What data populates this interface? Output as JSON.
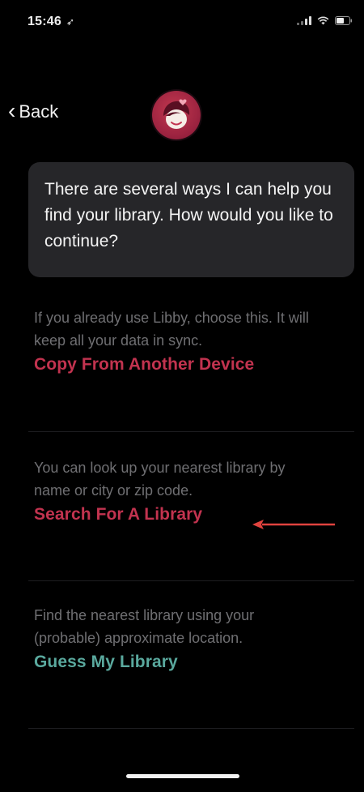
{
  "status_bar": {
    "time": "15:46",
    "colors": {
      "text": "#eeeeee"
    }
  },
  "nav": {
    "back_label": "Back"
  },
  "assistant": {
    "message": "There are several ways I can help you find your library. How would you like to continue?"
  },
  "options": [
    {
      "description": "If you already use Libby, choose this. It will keep all your data in sync.",
      "action": "Copy From Another Device",
      "action_color": "#c2334f"
    },
    {
      "description": "You can look up your nearest library by name or city or zip code.",
      "action": "Search For A Library",
      "action_color": "#c2334f"
    },
    {
      "description": "Find the nearest library using your (probable) approximate location.",
      "action": "Guess My Library",
      "action_color": "#5aa99e"
    }
  ],
  "annotation": {
    "arrow_color": "#e0433e"
  }
}
